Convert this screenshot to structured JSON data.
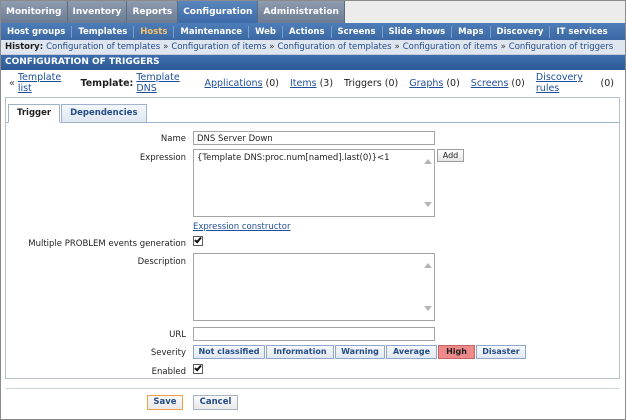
{
  "top_menu": [
    "Monitoring",
    "Inventory",
    "Reports",
    "Configuration",
    "Administration"
  ],
  "top_menu_active": "Configuration",
  "sub_menu": [
    "Host groups",
    "Templates",
    "Hosts",
    "Maintenance",
    "Web",
    "Actions",
    "Screens",
    "Slide shows",
    "Maps",
    "Discovery",
    "IT services"
  ],
  "sub_menu_active": "Hosts",
  "history": {
    "label": "History:",
    "items": [
      "Configuration of templates",
      "Configuration of items",
      "Configuration of templates",
      "Configuration of items",
      "Configuration of triggers"
    ],
    "separator": "»"
  },
  "page_title": "CONFIGURATION OF TRIGGERS",
  "nav": {
    "arrow": "«",
    "template_list": "Template list",
    "template_label": "Template:",
    "template_name": "Template DNS",
    "applications": {
      "label": "Applications",
      "count": "(0)"
    },
    "items": {
      "label": "Items",
      "count": "(3)"
    },
    "triggers": {
      "label": "Triggers",
      "count": "(0)"
    },
    "graphs": {
      "label": "Graphs",
      "count": "(0)"
    },
    "screens": {
      "label": "Screens",
      "count": "(0)"
    },
    "discovery_rules": {
      "label": "Discovery rules",
      "count": "(0)"
    }
  },
  "tabs": {
    "trigger": "Trigger",
    "dependencies": "Dependencies"
  },
  "form": {
    "name_label": "Name",
    "name_value": "DNS Server Down",
    "expression_label": "Expression",
    "expression_value": "{Template DNS:proc.num[named].last(0)}<1",
    "add_label": "Add",
    "expression_constructor": "Expression constructor",
    "multiple_problem_label": "Multiple PROBLEM events generation",
    "multiple_problem_checked": true,
    "description_label": "Description",
    "description_value": "",
    "url_label": "URL",
    "url_value": "",
    "severity_label": "Severity",
    "severity_options": [
      "Not classified",
      "Information",
      "Warning",
      "Average",
      "High",
      "Disaster"
    ],
    "severity_selected": "High",
    "enabled_label": "Enabled",
    "enabled_checked": true
  },
  "buttons": {
    "save": "Save",
    "cancel": "Cancel"
  },
  "colors": {
    "active_blue": "#3c6aa6",
    "submenu_blue": "#4d7db8",
    "severity_high": "#f08a8a",
    "active_submenu_text": "#f5c26b"
  }
}
